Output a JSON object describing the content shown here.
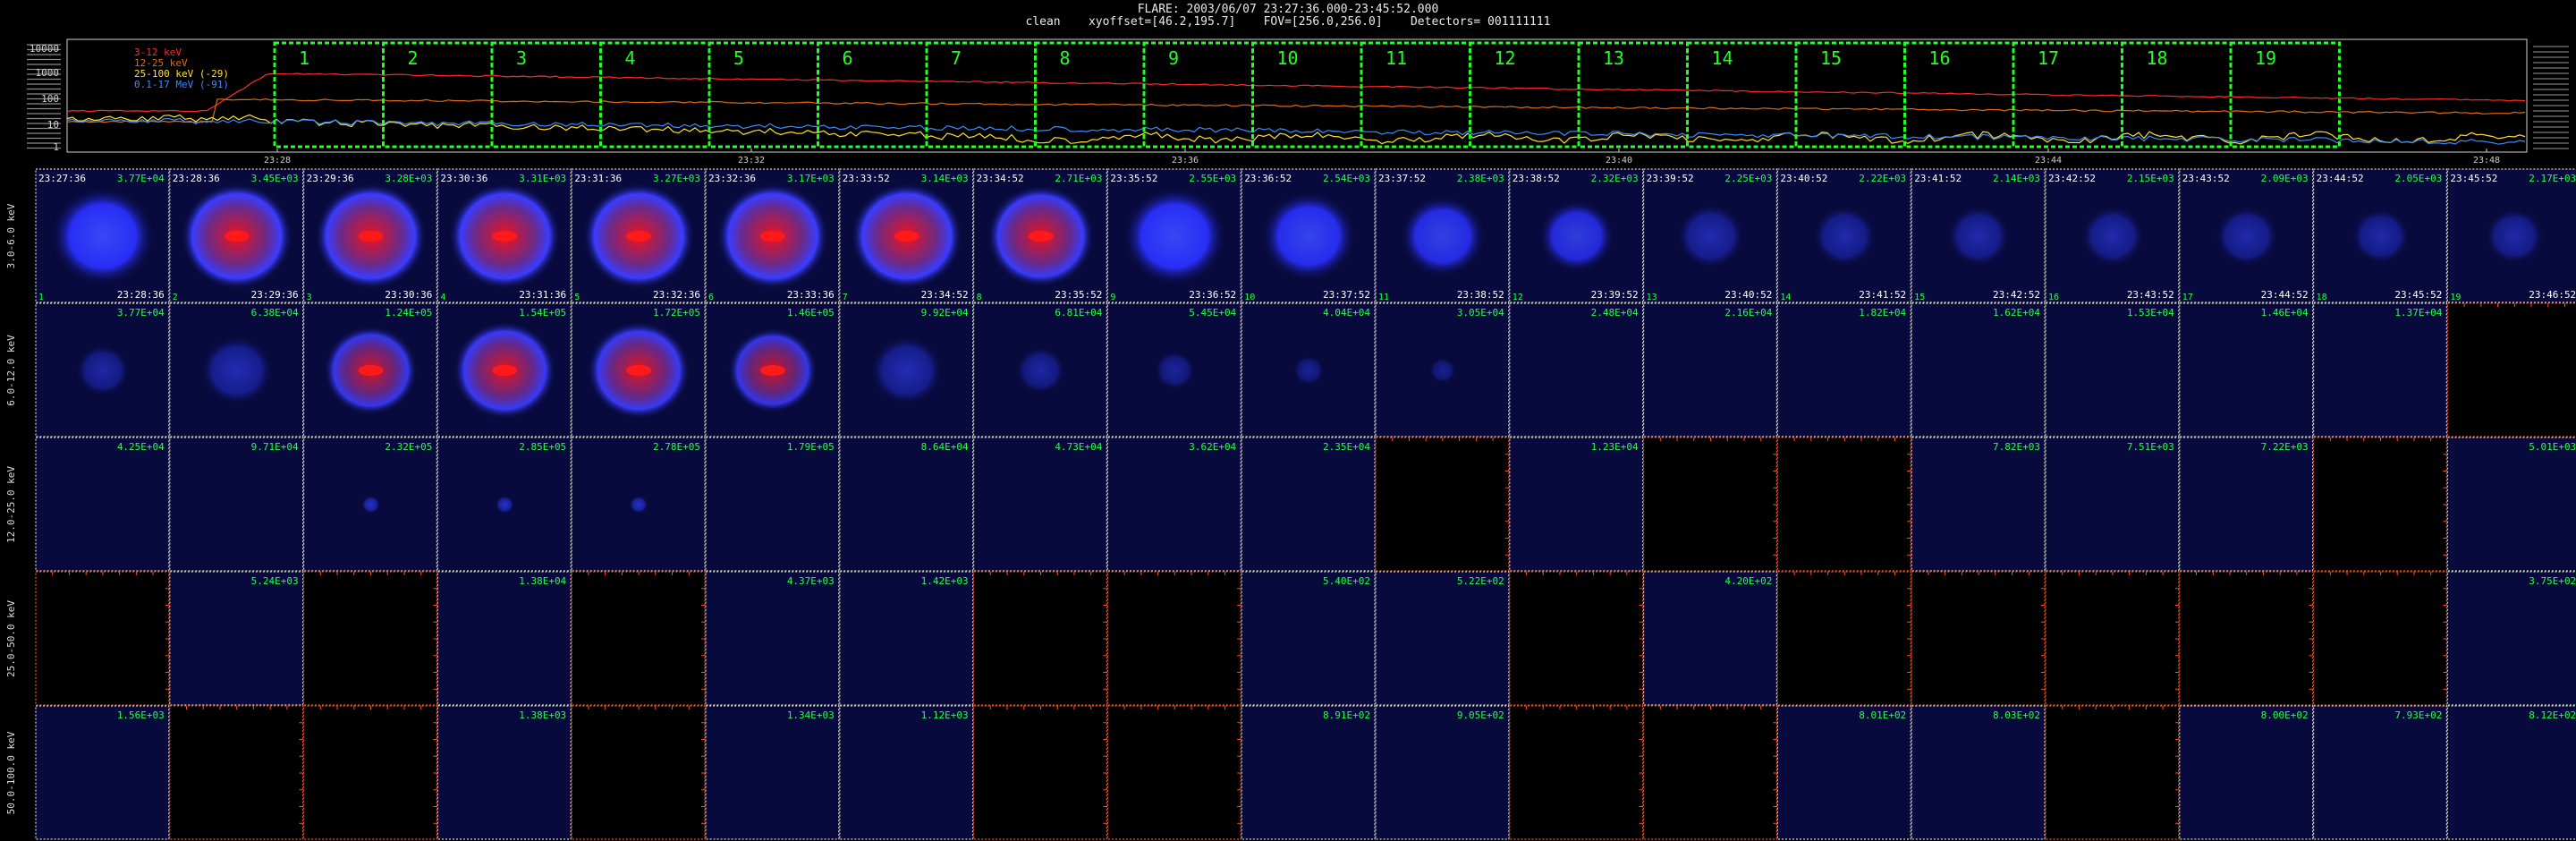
{
  "header": {
    "title": "FLARE: 2003/06/07 23:27:36.000-23:45:52.000",
    "subtitle": "clean    xyoffset=[46.2,195.7]    FOV=[256.0,256.0]    Detectors= 001111111"
  },
  "lightcurve": {
    "y_ticks": [
      "10000",
      "1000",
      "100",
      "10",
      "1"
    ],
    "time_ticks": [
      "23:28",
      "23:32",
      "23:36",
      "23:40",
      "23:44",
      "23:48"
    ],
    "legend": [
      {
        "label": "3-12 keV",
        "color": "#ff2a2a"
      },
      {
        "label": "12-25 keV",
        "color": "#e06a10"
      },
      {
        "label": "25-100 keV (-29)",
        "color": "#ffe030"
      },
      {
        "label": "0.1-17 MeV (-91)",
        "color": "#3a8cff"
      }
    ],
    "interval_labels": [
      "1",
      "2",
      "3",
      "4",
      "5",
      "6",
      "7",
      "8",
      "9",
      "10",
      "11",
      "12",
      "13",
      "14",
      "15",
      "16",
      "17",
      "18",
      "19"
    ]
  },
  "images": {
    "energy_bands": [
      "3.0-6.0 keV",
      "6.0-12.0 keV",
      "12.0-25.0 keV",
      "25.0-50.0 keV",
      "50.0-100.0 keV"
    ],
    "start_times": [
      "23:27:36",
      "23:28:36",
      "23:29:36",
      "23:30:36",
      "23:31:36",
      "23:32:36",
      "23:33:52",
      "23:34:52",
      "23:35:52",
      "23:36:52",
      "23:37:52",
      "23:38:52",
      "23:39:52",
      "23:40:52",
      "23:41:52",
      "23:42:52",
      "23:43:52",
      "23:44:52",
      "23:45:52"
    ],
    "end_times": [
      "23:28:36",
      "23:29:36",
      "23:30:36",
      "23:31:36",
      "23:32:36",
      "23:33:36",
      "23:34:52",
      "23:35:52",
      "23:36:52",
      "23:37:52",
      "23:38:52",
      "23:39:52",
      "23:40:52",
      "23:41:52",
      "23:42:52",
      "23:43:52",
      "23:44:52",
      "23:45:52",
      "23:46:52"
    ],
    "image_numbers": [
      "1",
      "2",
      "3",
      "4",
      "5",
      "6",
      "7",
      "8",
      "9",
      "10",
      "11",
      "12",
      "13",
      "14",
      "15",
      "16",
      "17",
      "18",
      "19"
    ],
    "max_values": [
      [
        "3.77E+04",
        "3.45E+03",
        "3.28E+03",
        "3.31E+03",
        "3.27E+03",
        "3.17E+03",
        "3.14E+03",
        "2.71E+03",
        "2.55E+03",
        "2.54E+03",
        "2.38E+03",
        "2.32E+03",
        "2.25E+03",
        "2.22E+03",
        "2.14E+03",
        "2.15E+03",
        "2.09E+03",
        "2.05E+03",
        "2.17E+03"
      ],
      [
        "3.77E+04",
        "6.38E+04",
        "1.24E+05",
        "1.54E+05",
        "1.72E+05",
        "1.46E+05",
        "9.92E+04",
        "6.81E+04",
        "5.45E+04",
        "4.04E+04",
        "3.05E+04",
        "2.48E+04",
        "2.16E+04",
        "1.82E+04",
        "1.62E+04",
        "1.53E+04",
        "1.46E+04",
        "1.37E+04",
        ""
      ],
      [
        "4.25E+04",
        "9.71E+04",
        "2.32E+05",
        "2.85E+05",
        "2.78E+05",
        "1.79E+05",
        "8.64E+04",
        "4.73E+04",
        "3.62E+04",
        "2.35E+04",
        "",
        "1.23E+04",
        "",
        "",
        "7.82E+03",
        "7.51E+03",
        "7.22E+03",
        "",
        "5.01E+03"
      ],
      [
        "",
        "5.24E+03",
        "",
        "1.38E+04",
        "",
        "4.37E+03",
        "1.42E+03",
        "",
        "",
        "5.40E+02",
        "5.22E+02",
        "",
        "4.20E+02",
        "",
        "",
        "",
        "",
        "",
        "3.75E+02"
      ],
      [
        "1.56E+03",
        "",
        "",
        "1.38E+03",
        "",
        "1.34E+03",
        "1.12E+03",
        "",
        "",
        "8.91E+02",
        "9.05E+02",
        "",
        "",
        "8.01E+02",
        "8.03E+02",
        "",
        "8.00E+02",
        "7.93E+02",
        "8.12E+02"
      ]
    ]
  }
}
